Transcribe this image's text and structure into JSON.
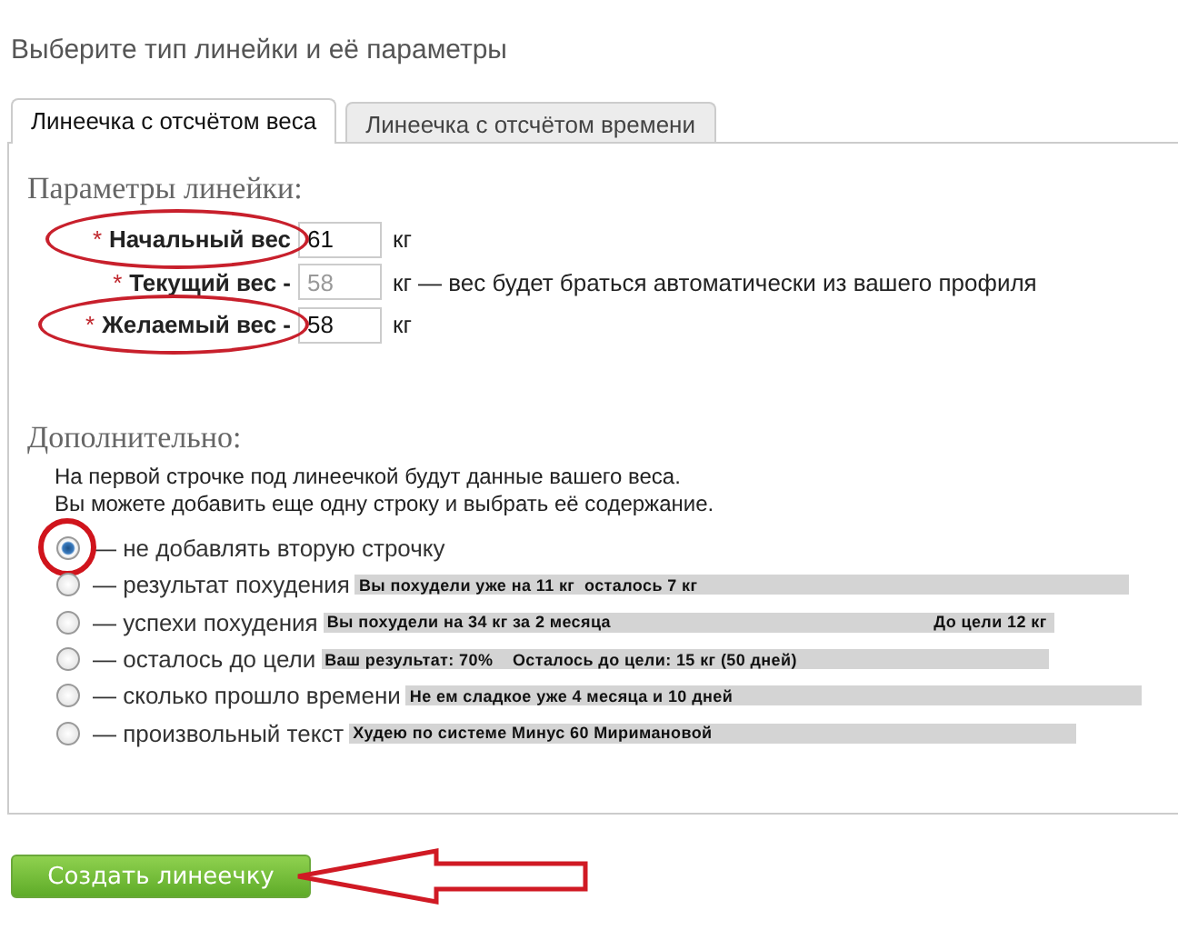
{
  "title": "Выберите тип линейки и её параметры",
  "tabs": [
    {
      "label": "Линеечка с отсчётом веса",
      "selected": true
    },
    {
      "label": "Линеечка с отсчётом времени",
      "selected": false
    }
  ],
  "params": {
    "heading": "Параметры линейки:",
    "fields": [
      {
        "required_mark": "*",
        "label": "Начальный вес",
        "value": "61",
        "unit": "кг",
        "disabled": false,
        "circled": true
      },
      {
        "required_mark": "*",
        "label": "Текущий вес -",
        "value": "58",
        "unit": "кг — вес будет браться автоматически из вашего профиля",
        "disabled": true,
        "circled": false
      },
      {
        "required_mark": "*",
        "label": "Желаемый вес -",
        "value": "58",
        "unit": "кг",
        "disabled": false,
        "circled": true
      }
    ]
  },
  "extra": {
    "heading": "Дополнительно:",
    "note": [
      "На первой строчке под линеечкой будут данные вашего веса.",
      "Вы можете добавить еще одну строку и выбрать её содержание."
    ],
    "options": [
      {
        "label": "— не добавлять вторую строчку",
        "selected": true,
        "circled": true
      },
      {
        "label": "— результат похудения",
        "selected": false,
        "circled": false,
        "preview": "Вы похудели уже на 11 кг  осталось 7 кг"
      },
      {
        "label": "— успехи похудения",
        "selected": false,
        "circled": false,
        "preview": "Вы похудели на 34 кг за 2 месяца",
        "preview_right": "До цели 12 кг"
      },
      {
        "label": "— осталось до цели",
        "selected": false,
        "circled": false,
        "preview": "Ваш результат: 70%    Осталось до цели: 15 кг (50 дней)"
      },
      {
        "label": "— сколько прошло времени",
        "selected": false,
        "circled": false,
        "preview": "Не ем сладкое уже 4 месяца и 10 дней"
      },
      {
        "label": "— произвольный текст",
        "selected": false,
        "circled": false,
        "preview": "Худею по системе Минус 60 Миримановой"
      }
    ]
  },
  "button": {
    "label": "Создать линеечку",
    "pointed": true
  }
}
